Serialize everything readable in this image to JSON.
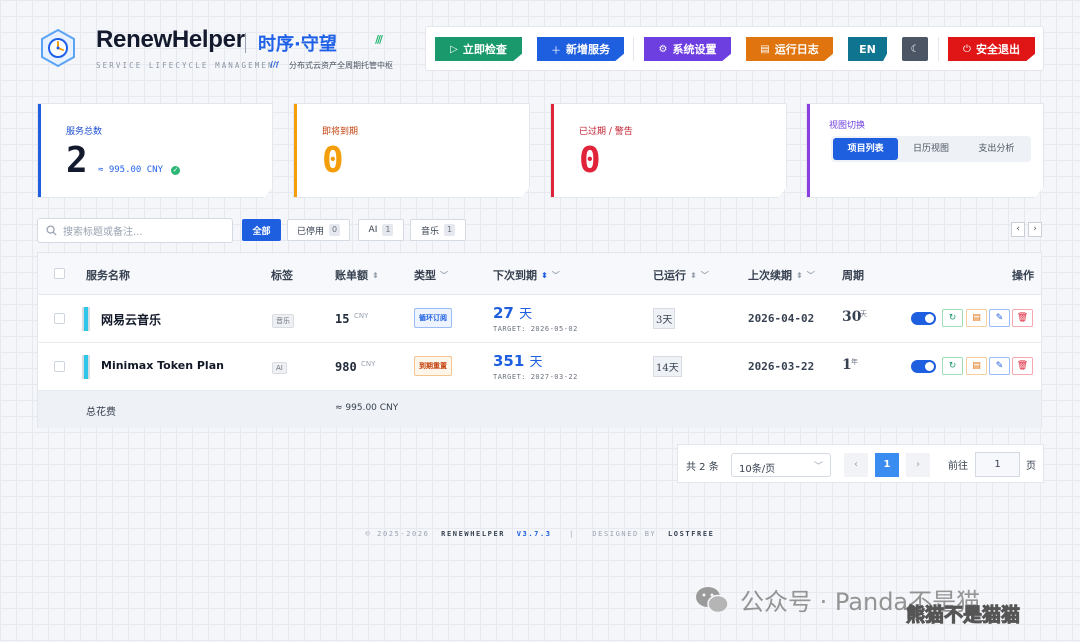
{
  "header": {
    "brand": "RenewHelper",
    "brand_cn": "时序·守望",
    "slashes": "///",
    "subtitle_en": "SERVICE LIFECYCLE MANAGEMENT",
    "subtitle_slash": "///",
    "subtitle_cn": "分布式云资产全周期托管中枢"
  },
  "toolbar": {
    "check": "立即检查",
    "add": "新增服务",
    "settings": "系统设置",
    "logs": "运行日志",
    "lang": "EN",
    "logout": "安全退出",
    "colors": {
      "check": "#1a9a6c",
      "add": "#1e5fe0",
      "settings": "#6d3fe0",
      "logs": "#e0740f",
      "lang": "#0e7490",
      "theme": "#4b5563",
      "logout": "#e01515"
    }
  },
  "stats": {
    "total_label": "服务总数",
    "total_value": "2",
    "total_approx": "≈ 995.00 CNY",
    "soon_label": "即将到期",
    "soon_value": "0",
    "expired_label": "已过期 / 警告",
    "expired_value": "0"
  },
  "view": {
    "label": "视图切换",
    "tabs": [
      "项目列表",
      "日历视图",
      "支出分析"
    ],
    "active": 0
  },
  "filter": {
    "search_placeholder": "搜索标题或备注...",
    "chips": [
      {
        "label": "全部",
        "count": ""
      },
      {
        "label": "已停用",
        "count": "0"
      },
      {
        "label": "AI",
        "count": "1"
      },
      {
        "label": "音乐",
        "count": "1"
      }
    ]
  },
  "table": {
    "headers": {
      "name": "服务名称",
      "tag": "标签",
      "amount": "账单额",
      "type": "类型",
      "next": "下次到期",
      "ran": "已运行",
      "last": "上次续期",
      "cycle": "周期",
      "action": "操作"
    },
    "rows": [
      {
        "name": "网易云音乐",
        "tag": "音乐",
        "amount": "15",
        "currency": "CNY",
        "type": "循环订阅",
        "days_num": "27",
        "days_unit": "天",
        "target": "TARGET: 2026-05-02",
        "ran": "3天",
        "last": "2026-04-02",
        "cycle": "30",
        "cycle_unit": "天"
      },
      {
        "name": "Minimax Token Plan",
        "tag": "AI",
        "amount": "980",
        "currency": "CNY",
        "type": "到期重置",
        "days_num": "351",
        "days_unit": "天",
        "target": "TARGET: 2027-03-22",
        "ran": "14天",
        "last": "2026-03-22",
        "cycle": "1",
        "cycle_unit": "年"
      }
    ],
    "footer_label": "总花费",
    "footer_total": "≈ 995.00 CNY"
  },
  "pager": {
    "total": "共 2 条",
    "page_size": "10条/页",
    "current": "1",
    "goto_label": "前往",
    "goto_value": "1",
    "goto_unit": "页"
  },
  "footer": {
    "copy": "© 2025-2026",
    "app": "RENEWHELPER",
    "version": "V3.7.3",
    "sep": "|",
    "designed": "DESIGNED BY",
    "author": "LOSTFREE"
  },
  "watermark": {
    "text": "公众号 · Panda不是猫",
    "overlay": "熊猫不是猫猫"
  }
}
